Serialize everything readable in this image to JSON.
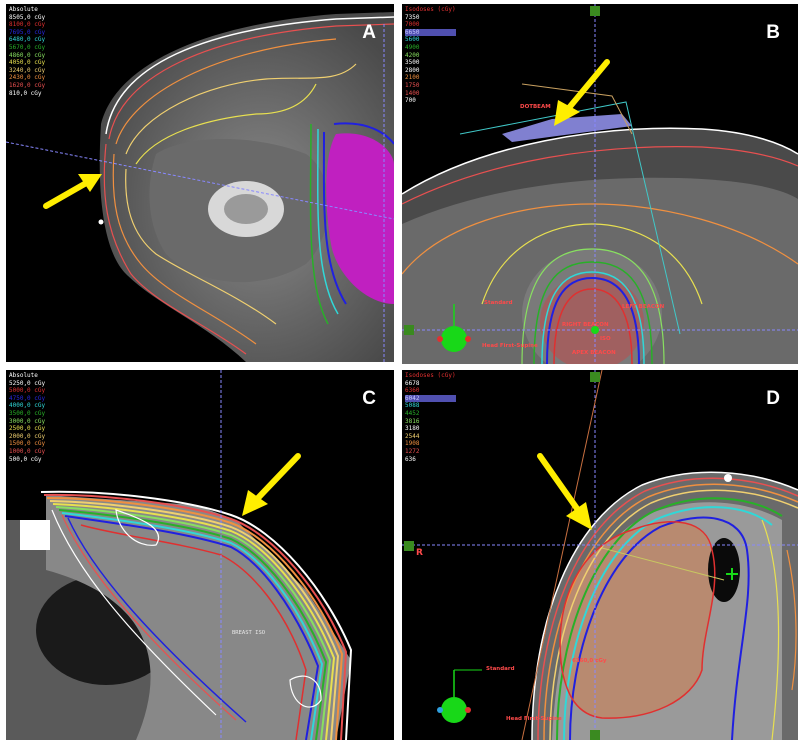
{
  "figure": {
    "panels": [
      {
        "id": "A",
        "label": "A",
        "legend_title": "Absolute",
        "legend": [
          {
            "text": "8505,0 cGy",
            "color": "#ffffff"
          },
          {
            "text": "8100,0 cGy",
            "color": "#e03030"
          },
          {
            "text": "7695,0 cGy",
            "color": "#2828e0"
          },
          {
            "text": "6480,0 cGy",
            "color": "#30d8d8"
          },
          {
            "text": "5670,0 cGy",
            "color": "#28b028"
          },
          {
            "text": "4860,0 cGy",
            "color": "#88e060"
          },
          {
            "text": "4050,0 cGy",
            "color": "#e8e050"
          },
          {
            "text": "3240,0 cGy",
            "color": "#f0d070"
          },
          {
            "text": "2430,0 cGy",
            "color": "#f09040"
          },
          {
            "text": "1620,0 cGy",
            "color": "#e85050"
          },
          {
            "text": "810,0 cGy",
            "color": "#ffffff"
          }
        ]
      },
      {
        "id": "B",
        "label": "B",
        "legend_title": "Isodoses (cGy)",
        "legend": [
          {
            "text": "7350",
            "color": "#ffffff"
          },
          {
            "text": "7000",
            "color": "#e03030"
          },
          {
            "text": "6650",
            "color": "#c8c8ff"
          },
          {
            "text": "5600",
            "color": "#30d8d8"
          },
          {
            "text": "4900",
            "color": "#28b028"
          },
          {
            "text": "4200",
            "color": "#88e060"
          },
          {
            "text": "3500",
            "color": "#ffffff"
          },
          {
            "text": "2800",
            "color": "#ffffff"
          },
          {
            "text": "2100",
            "color": "#f09040"
          },
          {
            "text": "1750",
            "color": "#e85050"
          },
          {
            "text": "1400",
            "color": "#e85050"
          },
          {
            "text": "700",
            "color": "#ffffff"
          }
        ],
        "annotations": [
          "DOTBEAM",
          "LEFT BEACON",
          "RIGHT BEACON",
          "ISO",
          "APEX BEACON",
          "Standard",
          "Head First-Supine"
        ]
      },
      {
        "id": "C",
        "label": "C",
        "legend_title": "Absolute",
        "legend": [
          {
            "text": "5250,0 cGy",
            "color": "#ffffff"
          },
          {
            "text": "5000,0 cGy",
            "color": "#e03030"
          },
          {
            "text": "4750,0 cGy",
            "color": "#2828e0"
          },
          {
            "text": "4000,0 cGy",
            "color": "#30d8d8"
          },
          {
            "text": "3500,0 cGy",
            "color": "#28b028"
          },
          {
            "text": "3000,0 cGy",
            "color": "#88e060"
          },
          {
            "text": "2500,0 cGy",
            "color": "#e8e050"
          },
          {
            "text": "2000,0 cGy",
            "color": "#f0d070"
          },
          {
            "text": "1500,0 cGy",
            "color": "#f09040"
          },
          {
            "text": "1000,0 cGy",
            "color": "#e85050"
          },
          {
            "text": "500,0 cGy",
            "color": "#ffffff"
          }
        ],
        "annotations": [
          "BREAST ISO"
        ]
      },
      {
        "id": "D",
        "label": "D",
        "legend_title": "Isodoses (cGy)",
        "legend": [
          {
            "text": "6678",
            "color": "#ffffff"
          },
          {
            "text": "6360",
            "color": "#e03030"
          },
          {
            "text": "6042",
            "color": "#c8c8ff"
          },
          {
            "text": "5088",
            "color": "#30d8d8"
          },
          {
            "text": "4452",
            "color": "#28b028"
          },
          {
            "text": "3816",
            "color": "#88e060"
          },
          {
            "text": "3180",
            "color": "#ffffff"
          },
          {
            "text": "2544",
            "color": "#f0d070"
          },
          {
            "text": "1908",
            "color": "#f09040"
          },
          {
            "text": "1272",
            "color": "#e85050"
          },
          {
            "text": "636",
            "color": "#ffffff"
          }
        ],
        "annotations": [
          "R",
          "Standard",
          "6360,0 cGy",
          "Head First-Supine"
        ]
      }
    ],
    "arrow_color": "#ffee00"
  }
}
